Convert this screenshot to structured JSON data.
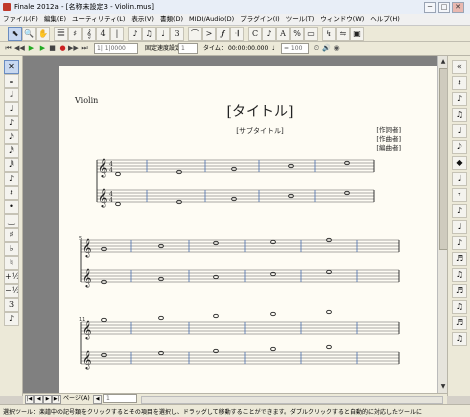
{
  "window": {
    "title": "Finale 2012a - [名称未設定3 - Violin.mus]",
    "controls": [
      "─",
      "□",
      "✕"
    ]
  },
  "menu": [
    "ファイル(F)",
    "編集(E)",
    "ユーティリティ(L)",
    "表示(V)",
    "書類(D)",
    "MIDI/Audio(D)",
    "プラグイン(I)",
    "ツール(T)",
    "ウィンドウ(W)",
    "ヘルプ(H)"
  ],
  "playback": {
    "measure_field": "1| 1|0000",
    "tempo_label": "固定速度設定：",
    "tempo_value": "1",
    "time_label": "タイム：",
    "time_value": "00:00:00.000",
    "quarter_eq": "= 100"
  },
  "score": {
    "part_name": "Violin",
    "title": "[タイトル]",
    "subtitle": "[サブタイトル]",
    "lyricist": "[作詞者]",
    "composer": "[作曲者]",
    "arranger": "[編曲者]",
    "measure_numbers": [
      "5",
      "11"
    ]
  },
  "pagenav": {
    "page_label": "ページ(A)",
    "page_value": "1"
  },
  "status": {
    "text": "選択ツール：楽譜中の記号類をクリックするとその項目を選択し、ドラッグして移動することができます。ダブルクリックすると自動的に対応したツールに"
  },
  "colors": {
    "barline": "#4a6fb0",
    "staff": "#555555",
    "page": "#fefcf4",
    "workspace": "#808080"
  }
}
